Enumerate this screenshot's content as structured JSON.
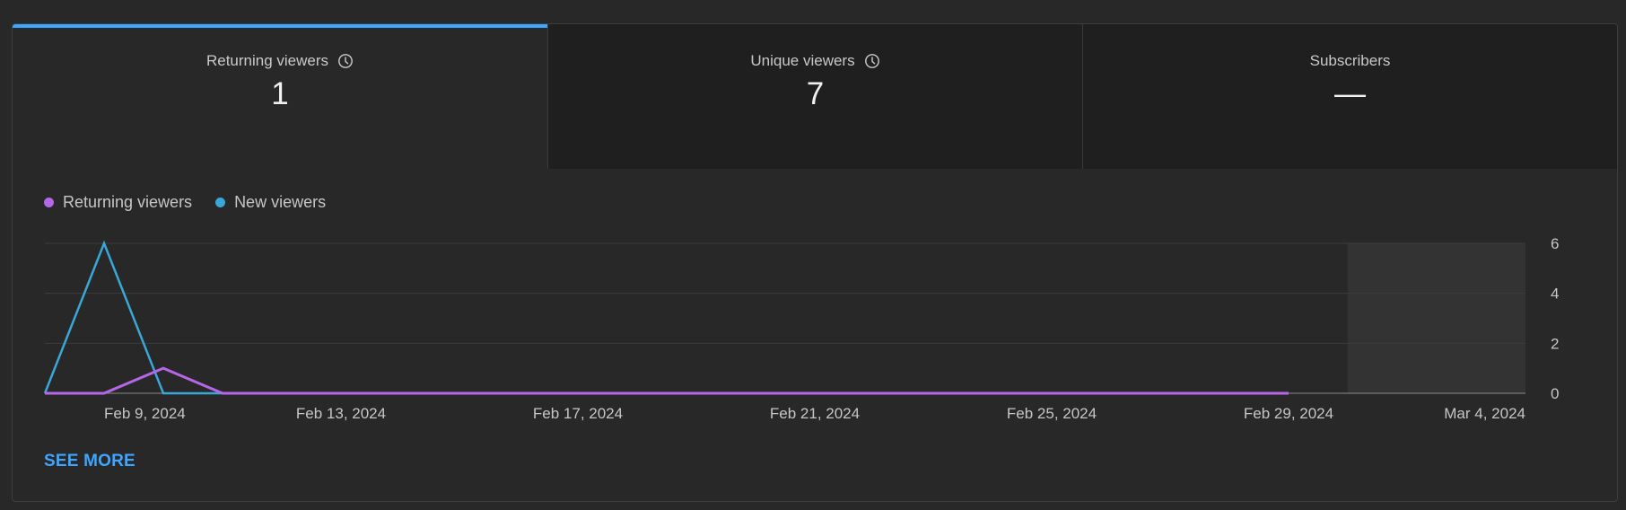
{
  "tabs": [
    {
      "label": "Returning viewers",
      "value": "1",
      "has_clock": true,
      "active": true
    },
    {
      "label": "Unique viewers",
      "value": "7",
      "has_clock": true,
      "active": false
    },
    {
      "label": "Subscribers",
      "value": "—",
      "has_clock": false,
      "active": false
    }
  ],
  "colors": {
    "returning": "#b467e8",
    "new": "#3aa7d6",
    "accent": "#3ea6ff"
  },
  "see_more": "SEE MORE",
  "chart_data": {
    "type": "line",
    "x": [
      "Feb 8, 2024",
      "Feb 9, 2024",
      "Feb 10, 2024",
      "Feb 11, 2024",
      "Feb 12, 2024",
      "Feb 13, 2024",
      "Feb 14, 2024",
      "Feb 15, 2024",
      "Feb 16, 2024",
      "Feb 17, 2024",
      "Feb 18, 2024",
      "Feb 19, 2024",
      "Feb 20, 2024",
      "Feb 21, 2024",
      "Feb 22, 2024",
      "Feb 23, 2024",
      "Feb 24, 2024",
      "Feb 25, 2024",
      "Feb 26, 2024",
      "Feb 27, 2024",
      "Feb 28, 2024",
      "Feb 29, 2024",
      "Mar 1, 2024",
      "Mar 2, 2024",
      "Mar 3, 2024",
      "Mar 4, 2024"
    ],
    "series": [
      {
        "name": "Returning viewers",
        "values": [
          0,
          0,
          1,
          0,
          0,
          0,
          0,
          0,
          0,
          0,
          0,
          0,
          0,
          0,
          0,
          0,
          0,
          0,
          0,
          0,
          0,
          0
        ]
      },
      {
        "name": "New viewers",
        "values": [
          0,
          6,
          0,
          0,
          0,
          0,
          0,
          0,
          0,
          0,
          0,
          0,
          0,
          0,
          0,
          0,
          0,
          0,
          0,
          0,
          0,
          0
        ]
      }
    ],
    "x_tick_labels": [
      "Feb 9, 2024",
      "Feb 13, 2024",
      "Feb 17, 2024",
      "Feb 21, 2024",
      "Feb 25, 2024",
      "Feb 29, 2024",
      "Mar 4, 2024"
    ],
    "y_tick_labels": [
      "0",
      "2",
      "4",
      "6"
    ],
    "ylim": [
      0,
      6
    ],
    "grid": true,
    "legend_position": "top-left",
    "shaded_region": {
      "start": "Mar 1, 2024",
      "end": "Mar 4, 2024"
    }
  }
}
